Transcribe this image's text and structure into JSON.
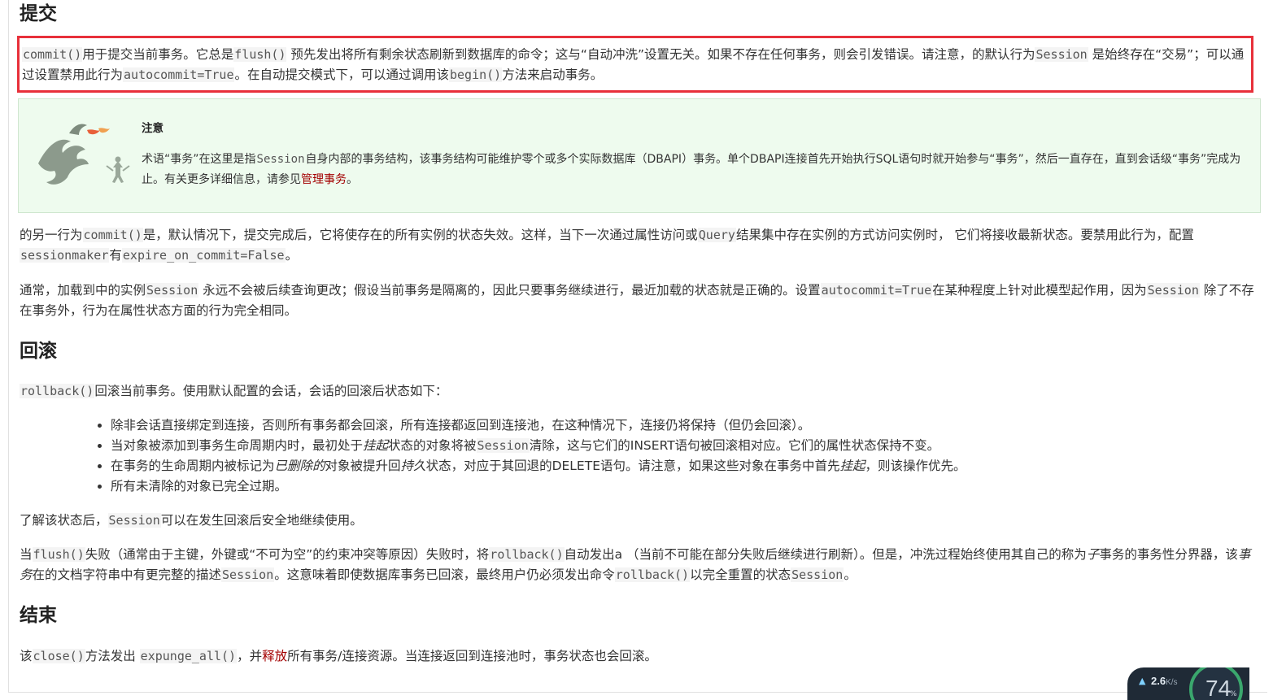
{
  "section_commit": {
    "heading": "提交",
    "p1": {
      "c1": "commit()",
      "t1": "用于提交当前事务。它总是",
      "c2": "flush()",
      "t2": " 预先发出将所有剩余状态刷新到数据库的命令；这与“自动冲洗”设置无关。如果不存在任何事务，则会引发错误。请注意，的默认行为",
      "c3": "Session",
      "t3": " 是始终存在“交易”；可以通过设置禁用此行为",
      "c4": "autocommit=True",
      "t4": "。在自动提交模式下，可以通过调用该",
      "c5": "begin()",
      "t5": "方法来启动事务。"
    },
    "note": {
      "title": "注意",
      "t1": "术语“事务”在这里是指",
      "c1": "Session",
      "t2": "自身内部的事务结构，该事务结构可能维护零个或多个实际数据库（DBAPI）事务。单个DBAPI连接首先开始执行SQL语句时就开始参与“事务”，然后一直存在，直到会话级“事务”完成为止。有关更多详细信息，请参见",
      "link": "管理事务",
      "t3": "。"
    },
    "p2": {
      "t1": "的另一行为",
      "c1": "commit()",
      "t2": "是，默认情况下，提交完成后，它将使存在的所有实例的状态失效。这样，当下一次通过属性访问或",
      "c2": "Query",
      "t3": "结果集中存在实例的方式访问实例时， 它们将接收最新状态。要禁用此行为，配置 ",
      "c3": "sessionmaker",
      "t4": "有",
      "c4": "expire_on_commit=False",
      "t5": "。"
    },
    "p3": {
      "t1": "通常，加载到中的实例",
      "c1": "Session",
      "t2": " 永远不会被后续查询更改；假设当前事务是隔离的，因此只要事务继续进行，最近加载的状态就是正确的。设置",
      "c2": "autocommit=True",
      "t3": "在某种程度上针对此模型起作用，因为",
      "c3": "Session",
      "t4": " 除了不存在事务外，行为在属性状态方面的行为完全相同。"
    }
  },
  "section_rollback": {
    "heading": "回滚",
    "p4": {
      "c1": "rollback()",
      "t1": "回滚当前事务。使用默认配置的会话，会话的回滚后状态如下："
    },
    "list": {
      "i1": "除非会话直接绑定到连接，否则所有事务都会回滚，所有连接都返回到连接池，在这种情况下，连接仍将保持（但仍会回滚）。",
      "i2_t1": "当对象被添加到事务生命周期内时，最初处于",
      "i2_em": "挂起",
      "i2_t2": "状态的对象将被",
      "i2_c": "Session",
      "i2_t3": "清除，这与它们的INSERT语句被回滚相对应。它们的属性状态保持不变。",
      "i3_t1": "在事务的生命周期内被标记为",
      "i3_em1": "已删除的",
      "i3_t2": "对象被提升回",
      "i3_em2": "持久",
      "i3_t3": "状态，对应于其回退的DELETE语句。请注意，如果这些对象在事务中首先",
      "i3_em3": "挂起",
      "i3_t4": "，则该操作优先。",
      "i4": "所有未清除的对象已完全过期。"
    },
    "p5": {
      "t1": "了解该状态后，",
      "c1": "Session",
      "t2": "可以在发生回滚后安全地继续使用。"
    },
    "p6": {
      "t1": "当",
      "c1": "flush()",
      "t2": "失败（通常由于主键，外键或“不可为空”的约束冲突等原因）失败时，将",
      "c2": "rollback()",
      "t3": "自动发出a （当前不可能在部分失败后继续进行刷新）。但是，冲洗过程始终使用其自己的称为",
      "em1": "子",
      "t4": "事务的事务性分界器，该",
      "em2": "事务",
      "t5": "在的文档字符串中有更完整的描述",
      "c3": "Session",
      "t6": "。这意味着即使数据库事务已回滚，最终用户仍必须发出命令",
      "c4": "rollback()",
      "t7": "以完全重置的状态",
      "c5": "Session",
      "t8": "。"
    }
  },
  "section_end": {
    "heading": "结束",
    "p7": {
      "t1": "该",
      "c1": "close()",
      "t2": "方法发出 ",
      "c2": "expunge_all()",
      "t3": "，并",
      "link": "释放",
      "t4": "所有事务/连接资源。当连接返回到连接池时，事务状态也会回滚。"
    }
  },
  "widget": {
    "upload_speed": "2.6",
    "unit": "K/s",
    "percent": "74",
    "percent_sign": "%"
  },
  "colors": {
    "highlight_border": "#e8303a",
    "note_bg": "#eefbee",
    "link": "#a30000"
  }
}
